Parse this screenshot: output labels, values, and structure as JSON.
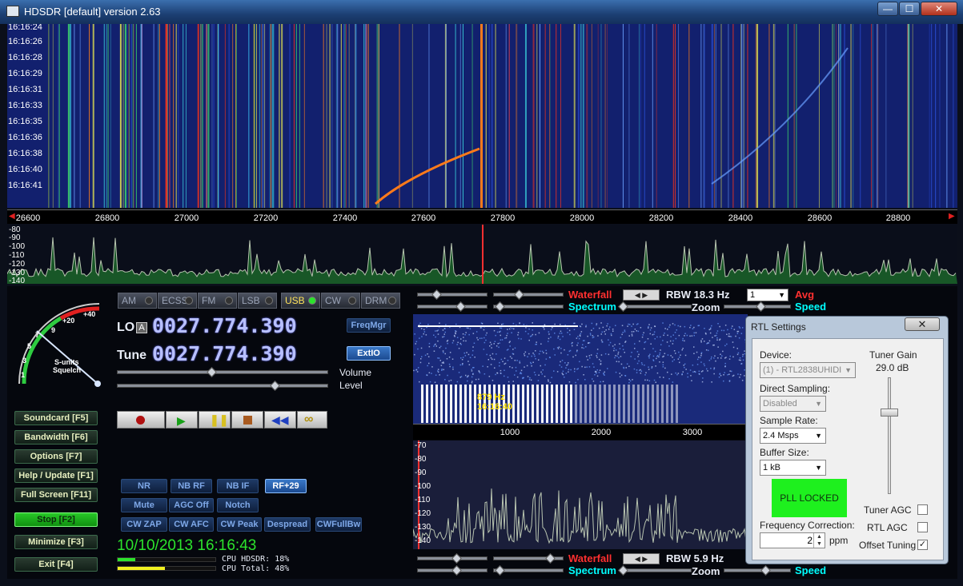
{
  "window": {
    "title": "HDSDR [default]  version 2.63",
    "minimize": "—",
    "maximize": "☐",
    "close": "✕"
  },
  "waterfall": {
    "times": [
      "16:16:24",
      "16:16:26",
      "16:16:28",
      "16:16:29",
      "16:16:31",
      "16:16:33",
      "16:16:35",
      "16:16:36",
      "16:16:38",
      "16:16:40",
      "16:16:41"
    ],
    "freq_ticks": [
      "26600",
      "26800",
      "27000",
      "27200",
      "27400",
      "27600",
      "27800",
      "28000",
      "28200",
      "28400",
      "28600",
      "28800"
    ]
  },
  "spectrum": {
    "db_labels": [
      "-80",
      "-90",
      "-100",
      "-110",
      "-120",
      "-130",
      "-140"
    ]
  },
  "smeter": {
    "label1": "S-units",
    "label2": "Squelch",
    "scale": [
      "1",
      "3",
      "5",
      "7",
      "9",
      "+20",
      "+40"
    ]
  },
  "modes": [
    {
      "label": "AM",
      "active": false
    },
    {
      "label": "ECSS",
      "active": false
    },
    {
      "label": "FM",
      "active": false
    },
    {
      "label": "LSB",
      "active": false
    },
    {
      "label": "USB",
      "active": true
    },
    {
      "label": "CW",
      "active": false
    },
    {
      "label": "DRM",
      "active": false
    }
  ],
  "lo": {
    "label": "LO",
    "badge": "A",
    "value": "0027.774.390"
  },
  "tune": {
    "label": "Tune",
    "value": "0027.774.390"
  },
  "freqmgr": "FreqMgr",
  "extio": "ExtIO",
  "volume_label": "Volume",
  "level_label": "Level",
  "volume_level": 0.45,
  "level_level": 0.75,
  "side_buttons": [
    {
      "label": "Soundcard",
      "key": "[F5]"
    },
    {
      "label": "Bandwidth",
      "key": "[F6]"
    },
    {
      "label": "Options",
      "key": "[F7]"
    },
    {
      "label": "Help / Update",
      "key": "[F1]"
    },
    {
      "label": "Full Screen",
      "key": "[F11]"
    },
    {
      "label": "Stop",
      "key": "[F2]"
    },
    {
      "label": "Minimize",
      "key": "[F3]"
    },
    {
      "label": "Exit",
      "key": "[F4]"
    }
  ],
  "dsp_buttons": {
    "row1": [
      "NR",
      "NB RF",
      "NB IF",
      "RF+29"
    ],
    "row2": [
      "Mute",
      "AGC Off",
      "Notch"
    ],
    "row3": [
      "CW ZAP",
      "CW AFC",
      "CW Peak",
      "Despread",
      "CWFullBw"
    ]
  },
  "datetime": "10/10/2013 16:16:43",
  "cpu": {
    "hdsdr": "CPU HDSDR: 18%",
    "total": "CPU Total: 48%",
    "hdsdr_level": 0.18,
    "total_level": 0.48
  },
  "top_controls": {
    "waterfall": "Waterfall",
    "spectrum": "Spectrum",
    "rbw": "RBW 18.3 Hz",
    "zoom": "Zoom",
    "avg_value": "1",
    "avg": "Avg",
    "speed": "Speed"
  },
  "bottom_controls": {
    "waterfall": "Waterfall",
    "spectrum": "Spectrum",
    "rbw": "RBW  5.9 Hz",
    "zoom": "Zoom",
    "speed": "Speed"
  },
  "audio": {
    "marker_freq": "879 Hz",
    "marker_time": "16:16:40",
    "ticks": [
      "1000",
      "2000",
      "3000"
    ],
    "db_labels": [
      "-70",
      "-80",
      "-90",
      "-100",
      "-110",
      "-120",
      "-130",
      "-140"
    ]
  },
  "rtl": {
    "title": "RTL Settings",
    "close": "✕",
    "device_label": "Device:",
    "device_value": "(1) - RTL2838UHIDI",
    "direct_sampling_label": "Direct Sampling:",
    "direct_sampling_value": "Disabled",
    "sample_rate_label": "Sample Rate:",
    "sample_rate_value": "2.4 Msps",
    "buffer_label": "Buffer Size:",
    "buffer_value": "1 kB",
    "pll": "PLL LOCKED",
    "freq_corr_label": "Frequency Correction:",
    "freq_corr_value": "2",
    "ppm": "ppm",
    "tuner_gain_label": "Tuner Gain",
    "tuner_gain_value": "29.0 dB",
    "tuner_agc": "Tuner AGC",
    "rtl_agc": "RTL AGC",
    "offset_tuning": "Offset Tuning",
    "offset_tuning_checked": "✓"
  }
}
